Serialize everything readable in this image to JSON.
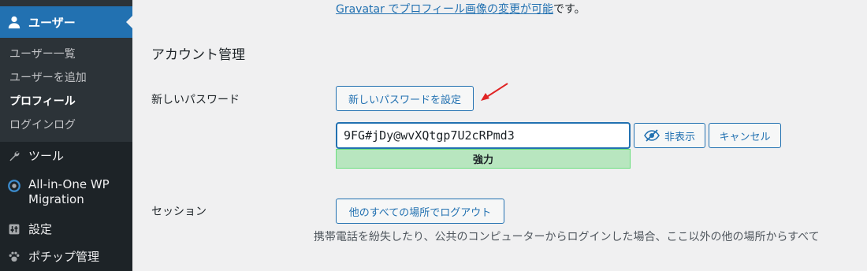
{
  "sidebar": {
    "active_menu": {
      "label": "ユーザー",
      "icon": "user-icon"
    },
    "submenu": [
      {
        "label": "ユーザー一覧"
      },
      {
        "label": "ユーザーを追加"
      },
      {
        "label": "プロフィール",
        "current": true
      },
      {
        "label": "ログインログ"
      }
    ],
    "menu_items": [
      {
        "label": "ツール",
        "icon": "wrench-icon"
      },
      {
        "label": "All-in-One WP Migration",
        "icon": "migration-icon"
      },
      {
        "label": "設定",
        "icon": "settings-icon"
      },
      {
        "label": "ポチップ管理",
        "icon": "paw-icon"
      }
    ],
    "colors": {
      "bg": "#1d2327",
      "active": "#2271b1",
      "submenu_bg": "#2c3338"
    }
  },
  "main": {
    "gravatar_link": "Gravatar でプロフィール画像の変更が可能",
    "gravatar_tail": "です。",
    "section_title": "アカウント管理",
    "new_password": {
      "label": "新しいパスワード",
      "set_button": "新しいパスワードを設定",
      "value": "9FG#jDy@wvXQtgp7U2cRPmd3",
      "hide_button": "非表示",
      "cancel_button": "キャンセル",
      "strength": "強力"
    },
    "sessions": {
      "label": "セッション",
      "logout_button": "他のすべての場所でログアウト",
      "description": "携帯電話を紛失したり、公共のコンピューターからログインした場合、ここ以外の他の場所からすべて"
    },
    "colors": {
      "accent": "#2271b1",
      "strong_bg": "#b8e6bf",
      "annotation_arrow": "#e02424"
    }
  }
}
